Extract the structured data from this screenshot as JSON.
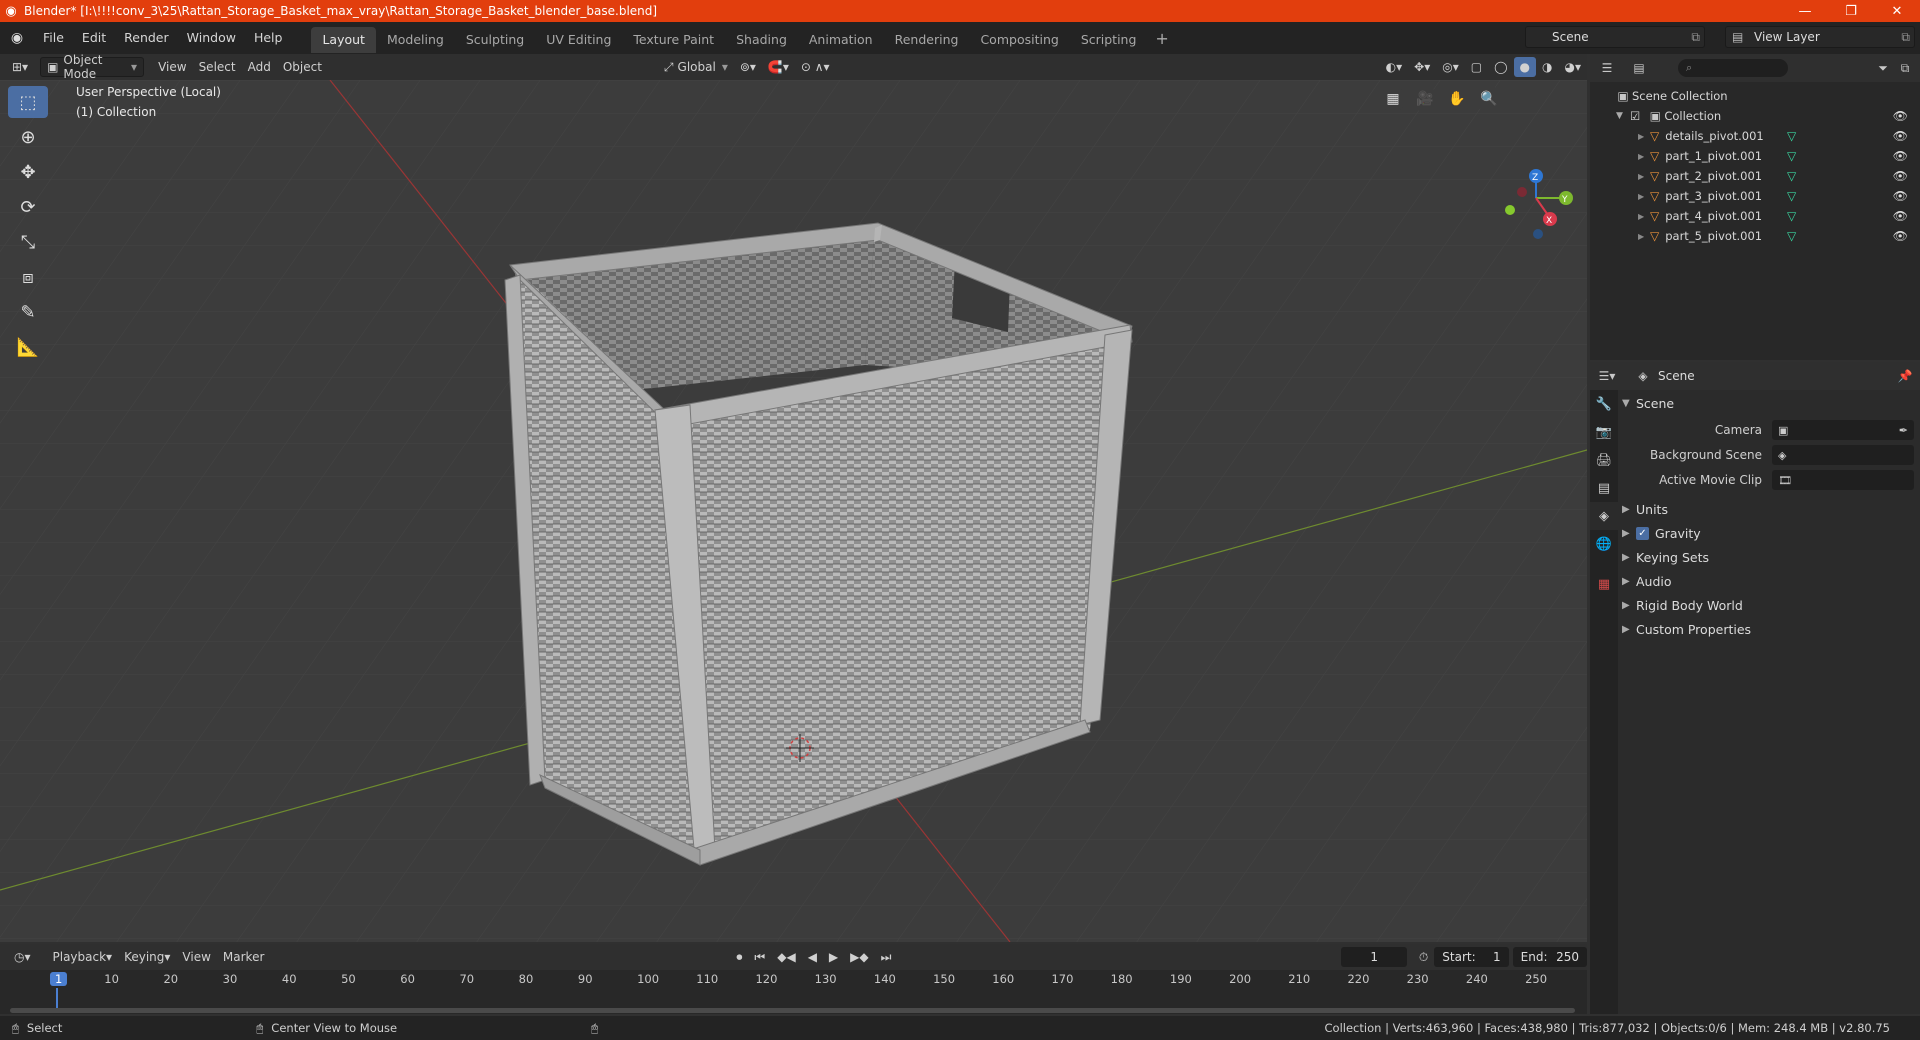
{
  "window": {
    "title": "Blender* [I:\\!!!!conv_3\\25\\Rattan_Storage_Basket_max_vray\\Rattan_Storage_Basket_blender_base.blend]",
    "minimize": "—",
    "restore": "❐",
    "close": "✕"
  },
  "menubar": {
    "menus": [
      "File",
      "Edit",
      "Render",
      "Window",
      "Help"
    ],
    "workspaces": [
      "Layout",
      "Modeling",
      "Sculpting",
      "UV Editing",
      "Texture Paint",
      "Shading",
      "Animation",
      "Rendering",
      "Compositing",
      "Scripting"
    ],
    "add_workspace": "+",
    "scene": "Scene",
    "view_layer": "View Layer"
  },
  "viewport_header": {
    "mode": "Object Mode",
    "menus": [
      "View",
      "Select",
      "Add",
      "Object"
    ],
    "orientation": "Global"
  },
  "viewport": {
    "perspective": "User Perspective (Local)",
    "collection": "(1) Collection",
    "gizmo": {
      "z": "Z",
      "y": "Y",
      "x": "X"
    }
  },
  "outliner": {
    "root": "Scene Collection",
    "collection": "Collection",
    "objects": [
      "details_pivot.001",
      "part_1_pivot.001",
      "part_2_pivot.001",
      "part_3_pivot.001",
      "part_4_pivot.001",
      "part_5_pivot.001"
    ]
  },
  "properties": {
    "context": "Scene",
    "section": "Scene",
    "camera_label": "Camera",
    "background_label": "Background Scene",
    "clip_label": "Active Movie Clip",
    "subsections": [
      "Units",
      "Gravity",
      "Keying Sets",
      "Audio",
      "Rigid Body World",
      "Custom Properties"
    ]
  },
  "timeline": {
    "menus": [
      "Playback",
      "Keying",
      "View",
      "Marker"
    ],
    "current_frame": "1",
    "start_label": "Start:",
    "start": "1",
    "end_label": "End:",
    "end": "250",
    "ruler": [
      "1",
      "10",
      "20",
      "30",
      "40",
      "50",
      "60",
      "70",
      "80",
      "90",
      "100",
      "110",
      "120",
      "130",
      "140",
      "150",
      "160",
      "170",
      "180",
      "190",
      "200",
      "210",
      "220",
      "230",
      "240",
      "250"
    ]
  },
  "statusbar": {
    "select": "Select",
    "center_view": "Center View to Mouse",
    "stats": "Collection | Verts:463,960 | Faces:438,980 | Tris:877,032 | Objects:0/6 | Mem: 248.4 MB | v2.80.75"
  },
  "colors": {
    "titlebar": "#e23e0d",
    "active_tool": "#4b6ea3",
    "object_icon": "#e8903a",
    "mesh_icon": "#3ad4a0",
    "frame_marker": "#4b7fd1"
  }
}
